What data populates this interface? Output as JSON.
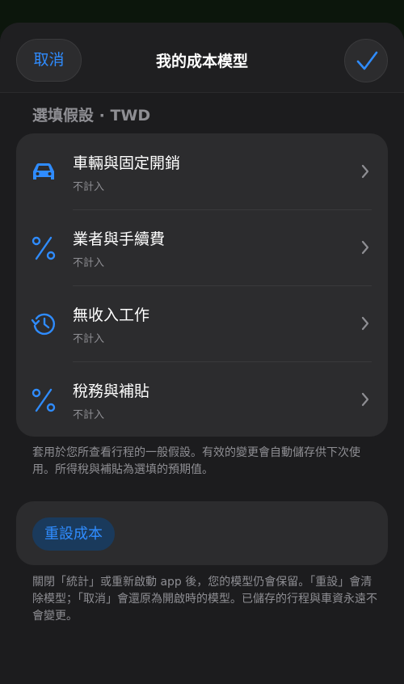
{
  "nav": {
    "cancel_label": "取消",
    "title": "我的成本模型",
    "done_icon": "checkmark-icon"
  },
  "section_header": "選填假設 · TWD",
  "rows": [
    {
      "label": "車輛與固定開銷",
      "sub": "不計入",
      "icon": "car-icon"
    },
    {
      "label": "業者與手續費",
      "sub": "不計入",
      "icon": "percent-icon"
    },
    {
      "label": "無收入工作",
      "sub": "不計入",
      "icon": "clock-history-icon"
    },
    {
      "label": "稅務與補貼",
      "sub": "不計入",
      "icon": "percent-icon"
    }
  ],
  "footer_note": "套用於您所查看行程的一般假設。有效的變更會自動儲存供下次使用。所得稅與補貼為選填的預期值。",
  "reset_label": "重設成本",
  "footer_note2": "關閉「統計」或重新啟動 app 後，您的模型仍會保留。「重設」會清除模型；「取消」會還原為開啟時的模型。已儲存的行程與車資永遠不會變更。",
  "colors": {
    "accent": "#2f8cff",
    "background": "#1c1c1e",
    "group_background": "#2c2c2e",
    "secondary_text": "#8e8e93"
  }
}
